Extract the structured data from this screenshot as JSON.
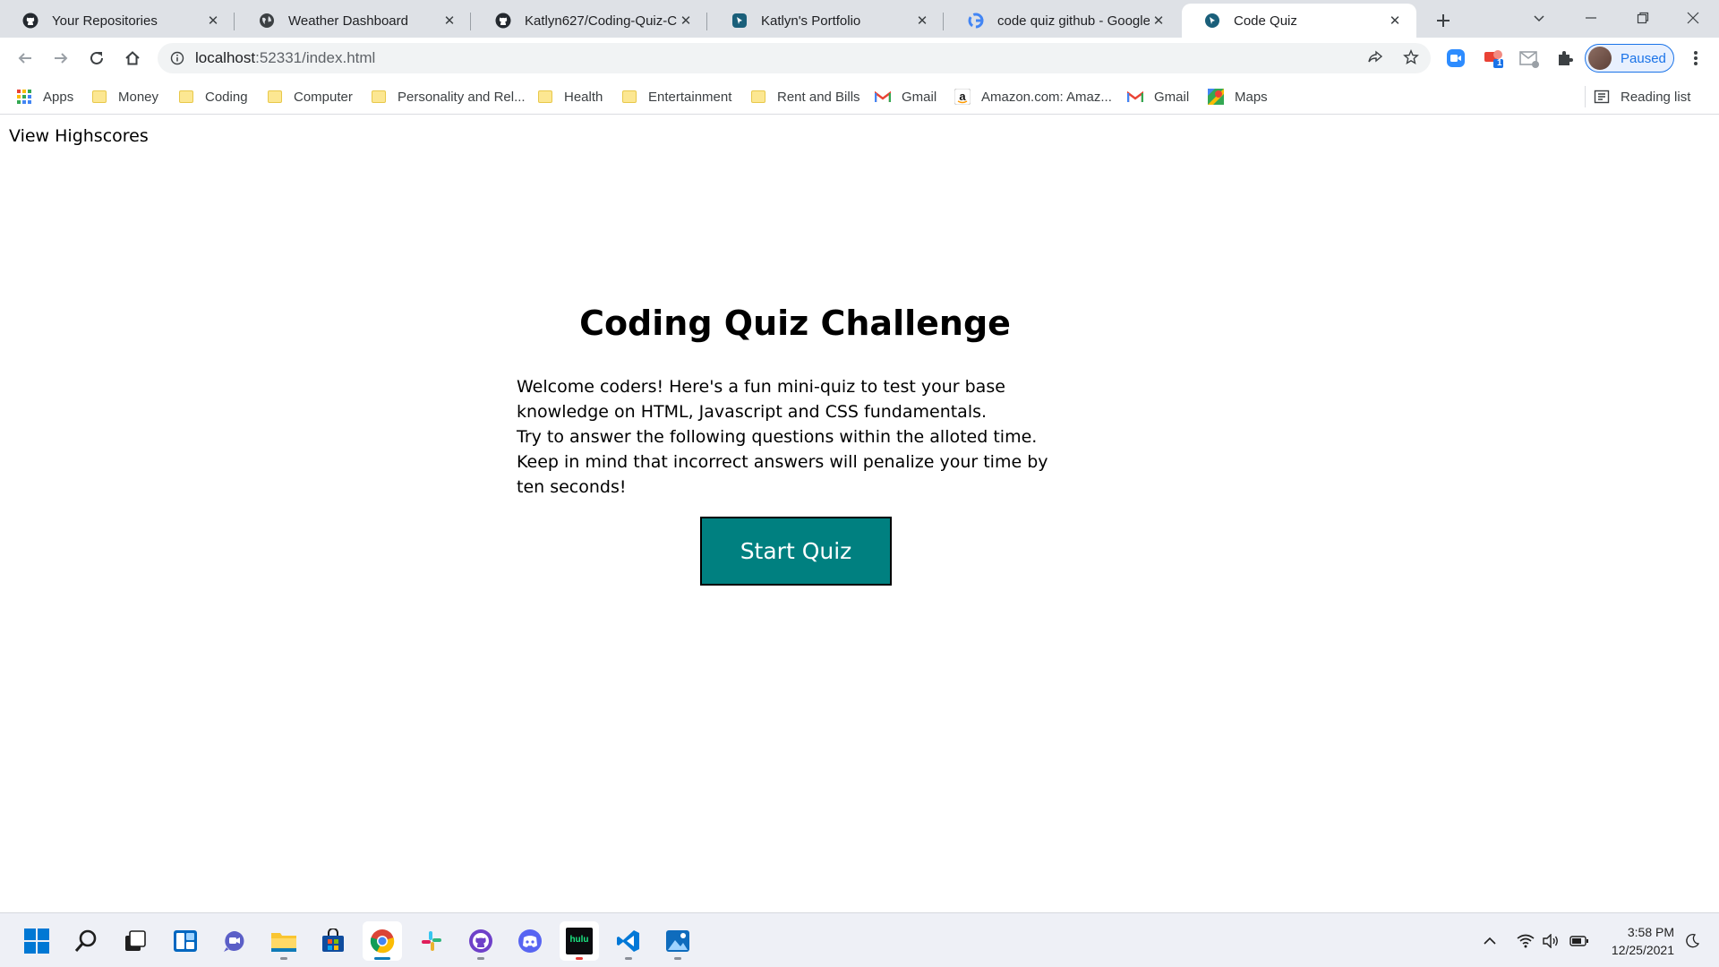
{
  "browser": {
    "tabs": [
      {
        "title": "Your Repositories",
        "icon": "github-icon"
      },
      {
        "title": "Weather Dashboard",
        "icon": "globe-icon"
      },
      {
        "title": "Katlyn627/Coding-Quiz-Ch",
        "icon": "github-icon"
      },
      {
        "title": "Katlyn's Portfolio",
        "icon": "site-icon"
      },
      {
        "title": "code quiz github - Google",
        "icon": "google-icon"
      },
      {
        "title": "Code Quiz",
        "icon": "site-icon",
        "active": true
      }
    ],
    "address": {
      "host": "localhost",
      "rest": ":52331/index.html"
    },
    "profile_label": "Paused",
    "bookmarks": [
      {
        "label": "Apps",
        "icon": "apps-grid-icon"
      },
      {
        "label": "Money",
        "icon": "folder-icon"
      },
      {
        "label": "Coding",
        "icon": "folder-icon"
      },
      {
        "label": "Computer",
        "icon": "folder-icon"
      },
      {
        "label": "Personality and Rel...",
        "icon": "folder-icon"
      },
      {
        "label": "Health",
        "icon": "folder-icon"
      },
      {
        "label": "Entertainment",
        "icon": "folder-icon"
      },
      {
        "label": "Rent and Bills",
        "icon": "folder-icon"
      },
      {
        "label": "Gmail",
        "icon": "gmail-icon"
      },
      {
        "label": "Amazon.com: Amaz...",
        "icon": "amazon-icon"
      },
      {
        "label": "Gmail",
        "icon": "gmail-icon"
      },
      {
        "label": "Maps",
        "icon": "maps-icon"
      }
    ],
    "reading_list": "Reading list",
    "extension_badges": {
      "screencast": "1"
    }
  },
  "page": {
    "highscores_link": "View Highscores",
    "title": "Coding Quiz Challenge",
    "intro_lines": [
      "Welcome coders! Here's a fun mini-quiz to test your base knowledge on HTML, Javascript and CSS fundamentals.",
      "Try to answer the following questions within the alloted time.",
      "Keep in mind that incorrect answers will penalize your time by ten seconds!"
    ],
    "start_button": "Start Quiz"
  },
  "taskbar": {
    "apps": [
      "start-icon",
      "search-icon",
      "task-view-icon",
      "widgets-icon",
      "teams-chat-icon",
      "file-explorer-icon",
      "ms-store-icon",
      "chrome-icon",
      "slack-icon",
      "github-desktop-icon",
      "discord-icon",
      "hulu-icon",
      "vscode-icon",
      "photos-icon"
    ],
    "hulu_label": "hulu",
    "time": "3:58 PM",
    "date": "12/25/2021"
  },
  "colors": {
    "accent": "#008080",
    "tabstrip": "#dee1e6",
    "profile_blue": "#1a73e8"
  }
}
